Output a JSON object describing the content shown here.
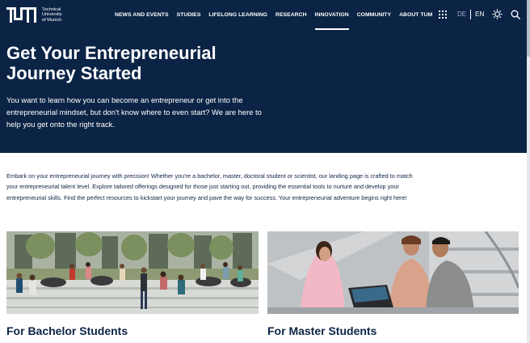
{
  "header": {
    "logo": {
      "lines": [
        "Technical",
        "University",
        "of Munich"
      ]
    },
    "nav": [
      {
        "label": "NEWS AND EVENTS"
      },
      {
        "label": "STUDIES"
      },
      {
        "label": "LIFELONG LEARNING"
      },
      {
        "label": "RESEARCH"
      },
      {
        "label": "INNOVATION",
        "active": true
      },
      {
        "label": "COMMUNITY"
      },
      {
        "label": "ABOUT TUM"
      }
    ],
    "tools": {
      "apps_icon": "grid-icon",
      "lang_de": "DE",
      "lang_en": "EN",
      "theme_icon": "sun-icon",
      "search_icon": "search-icon"
    }
  },
  "hero": {
    "title_line1": "Get Your Entrepreneurial",
    "title_line2": "Journey Started",
    "description": "You want to learn how you can become an entrepreneur or get into the entrepreneurial mindset, but don't know where to even start? We are here to help you get onto the right track."
  },
  "intro": {
    "text": "Embark on your entrepreneurial journey with precision! Whether you're a bachelor, master, doctoral student or scientist, our landing page is crafted to match your entrepreneurial talent level. Explore tailored offerings designed for those just starting out, providing the essential tools to nurture and develop your entrepreneurial skills. Find the perfect resources to kickstart your journey and pave the way for success. Your entrepreneurial adventure begins right here!"
  },
  "cards": [
    {
      "title": "For Bachelor Students"
    },
    {
      "title": "For Master Students"
    }
  ],
  "colors": {
    "brand_navy": "#0b2446",
    "text": "#0e2342",
    "background": "#ffffff"
  }
}
